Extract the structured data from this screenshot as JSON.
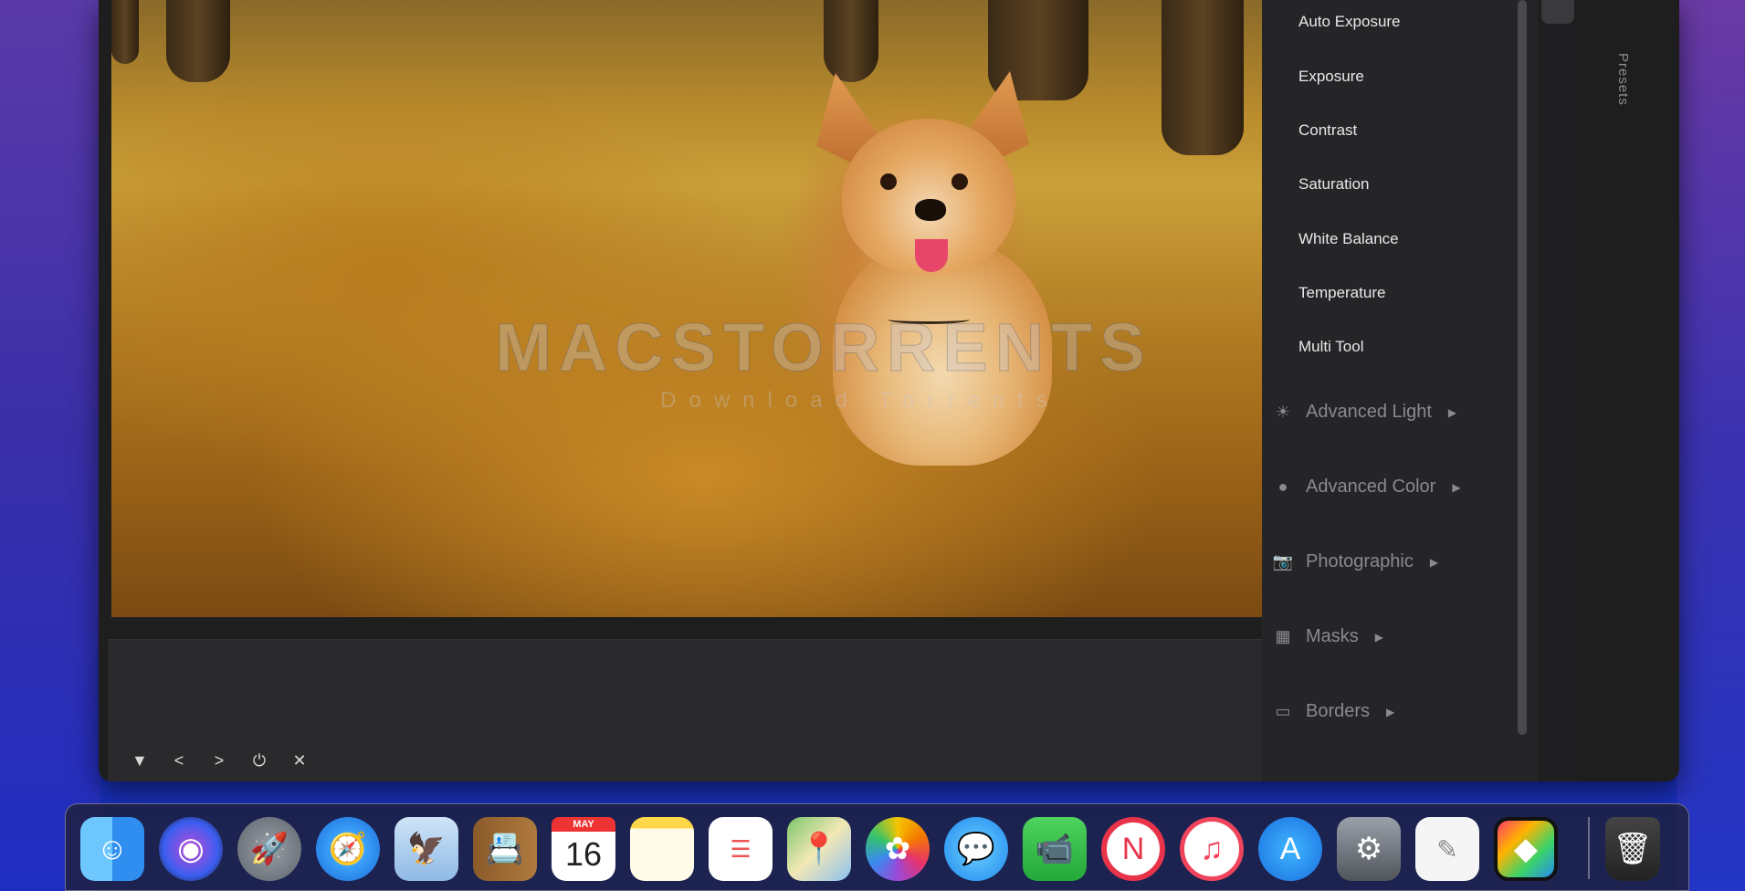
{
  "panel": {
    "tools": [
      "Auto Exposure",
      "Exposure",
      "Contrast",
      "Saturation",
      "White Balance",
      "Temperature",
      "Multi Tool"
    ],
    "groups": [
      {
        "label": "Advanced Light",
        "icon": "sun-icon"
      },
      {
        "label": "Advanced Color",
        "icon": "color-circle-icon"
      },
      {
        "label": "Photographic",
        "icon": "camera-icon"
      },
      {
        "label": "Masks",
        "icon": "checkerboard-icon"
      },
      {
        "label": "Borders",
        "icon": "border-frame-icon"
      }
    ],
    "presets_tab": "Presets"
  },
  "canvas": {
    "watermark": "MACSTORRENTS",
    "watermark_sub": "Download Torrents"
  },
  "filmstrip": {
    "controls": [
      "▼",
      "<",
      ">",
      "⏻",
      "✕"
    ]
  },
  "dock": {
    "calendar": {
      "month": "MAY",
      "day": "16"
    },
    "apps": [
      "Finder",
      "Siri",
      "Launchpad",
      "Safari",
      "Mail",
      "Contacts",
      "Calendar",
      "Notes",
      "Reminders",
      "Maps",
      "Photos",
      "Messages",
      "FaceTime",
      "News",
      "Music",
      "App Store",
      "System Preferences",
      "TextEdit",
      "Photo app",
      "Trash"
    ]
  },
  "colors": {
    "panel_bg": "#252527",
    "window_bg": "#1e1e1f",
    "accent_text": "#e8e8ea",
    "muted_text": "#8a8a8e"
  }
}
